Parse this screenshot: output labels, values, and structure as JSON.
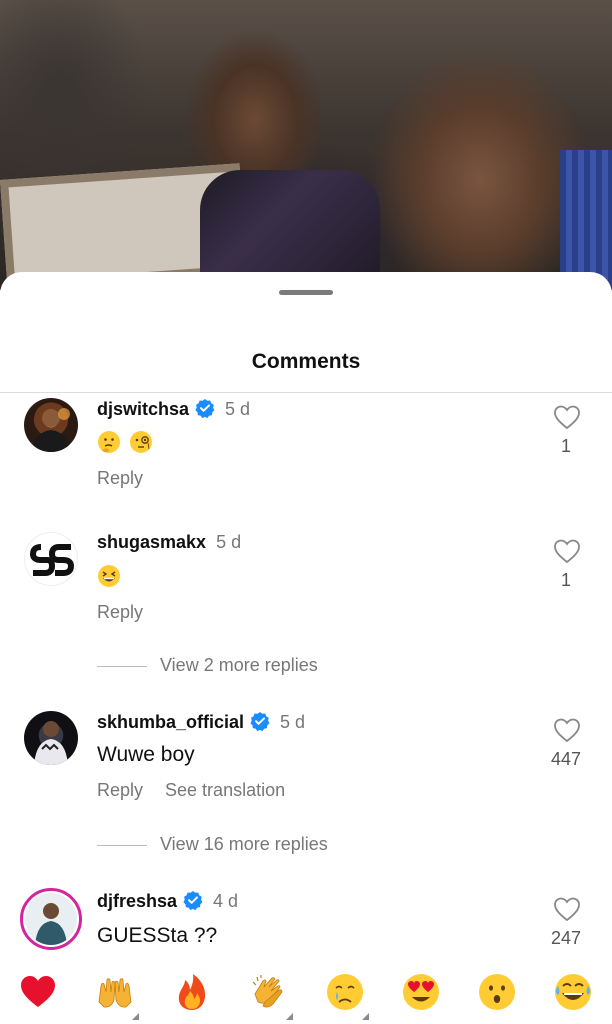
{
  "sheet": {
    "title": "Comments"
  },
  "comments": [
    {
      "username": "djswitchsa",
      "verified": true,
      "time": "5 d",
      "text": "",
      "emojis": [
        "thinking-face",
        "face-with-monocle"
      ],
      "reply_label": "Reply",
      "likes": "1"
    },
    {
      "username": "shugasmakx",
      "verified": false,
      "time": "5 d",
      "text": "",
      "emojis": [
        "grinning-squinting-face"
      ],
      "reply_label": "Reply",
      "likes": "1",
      "view_more": "View 2 more replies"
    },
    {
      "username": "skhumba_official",
      "verified": true,
      "time": "5 d",
      "text": "Wuwe boy",
      "reply_label": "Reply",
      "translate_label": "See translation",
      "likes": "447",
      "view_more": "View 16 more replies"
    },
    {
      "username": "djfreshsa",
      "verified": true,
      "time": "4 d",
      "text": "GUESSta ??",
      "reply_label": "Reply",
      "likes": "247"
    }
  ],
  "emoji_bar": [
    "red-heart",
    "raising-hands",
    "fire",
    "clapping-hands",
    "crying-face",
    "heart-eyes",
    "hushed-face",
    "tears-of-joy"
  ],
  "colors": {
    "verified": "#1a8cff",
    "muted": "#777777",
    "heart": "#e8112d"
  }
}
